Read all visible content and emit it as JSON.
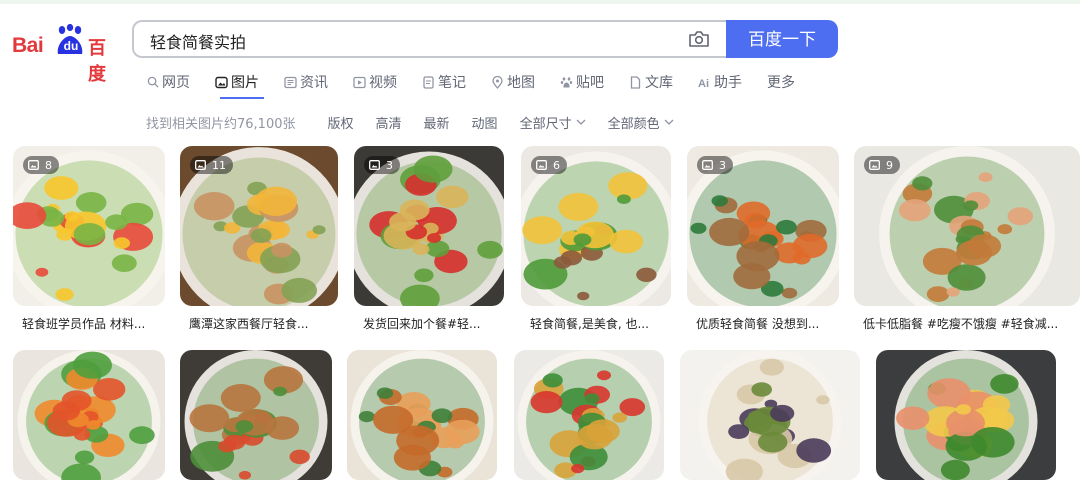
{
  "brand": {
    "bai": "Bai",
    "du": "du",
    "cn": "百度"
  },
  "search": {
    "query": "轻食简餐实拍",
    "button": "百度一下"
  },
  "tabs": [
    {
      "label": "网页",
      "icon": "search-icon",
      "active": false
    },
    {
      "label": "图片",
      "icon": "image-icon",
      "active": true
    },
    {
      "label": "资讯",
      "icon": "news-icon",
      "active": false
    },
    {
      "label": "视频",
      "icon": "video-icon",
      "active": false
    },
    {
      "label": "笔记",
      "icon": "note-icon",
      "active": false
    },
    {
      "label": "地图",
      "icon": "map-icon",
      "active": false
    },
    {
      "label": "贴吧",
      "icon": "tieba-icon",
      "active": false
    },
    {
      "label": "文库",
      "icon": "doc-icon",
      "active": false
    },
    {
      "label": "助手",
      "icon": "ai-icon",
      "active": false
    },
    {
      "label": "更多",
      "icon": "",
      "active": false
    }
  ],
  "filters": {
    "count": "找到相关图片约76,100张",
    "items": [
      "版权",
      "高清",
      "最新",
      "动图",
      "全部尺寸",
      "全部颜色"
    ]
  },
  "row1": [
    {
      "count": "8",
      "caption": "轻食班学员作品 材料...",
      "theme": [
        "#f2efe9",
        "#f7c62c",
        "#e84a3a",
        "#79b545"
      ]
    },
    {
      "count": "11",
      "caption": "鹰潭这家西餐厅轻食...",
      "theme": [
        "#6b4a2e",
        "#c89262",
        "#f2b63a",
        "#83a254"
      ]
    },
    {
      "count": "3",
      "caption": "发货回来加个餐#轻...",
      "theme": [
        "#3c3a36",
        "#d9b45a",
        "#d6302c",
        "#5f9e3c"
      ]
    },
    {
      "count": "6",
      "caption": "轻食简餐,是美食, 也...",
      "theme": [
        "#ece9e4",
        "#f2c23a",
        "#8b5a3c",
        "#4f9a3a"
      ]
    },
    {
      "count": "3",
      "caption": "优质轻食简餐 没想到...",
      "theme": [
        "#eeeae2",
        "#a06c3c",
        "#e06a2a",
        "#2e7a3a"
      ]
    },
    {
      "count": "9",
      "caption": "低卡低脂餐 #吃瘦不饿瘦 #轻食减...",
      "theme": [
        "#eae8e3",
        "#c27a3a",
        "#e4a37a",
        "#4f8e3a"
      ]
    }
  ],
  "row2": [
    {
      "theme": [
        "#eae6df",
        "#e3532a",
        "#f08a2c",
        "#4f9e3e"
      ]
    },
    {
      "theme": [
        "#3f3b37",
        "#b8763e",
        "#d94a2c",
        "#4d8f3a"
      ]
    },
    {
      "theme": [
        "#e9e3d8",
        "#c46a2a",
        "#e8a05a",
        "#3f7f3a"
      ]
    },
    {
      "theme": [
        "#eceae6",
        "#d9a23a",
        "#d8352c",
        "#3e8e3a"
      ]
    },
    {
      "theme": [
        "#f3f2ef",
        "#4a3a5a",
        "#6a8a3a",
        "#d8c8a8"
      ]
    },
    {
      "theme": [
        "#3b3d3e",
        "#f3c94a",
        "#e8906a",
        "#3e8a2e"
      ]
    }
  ]
}
